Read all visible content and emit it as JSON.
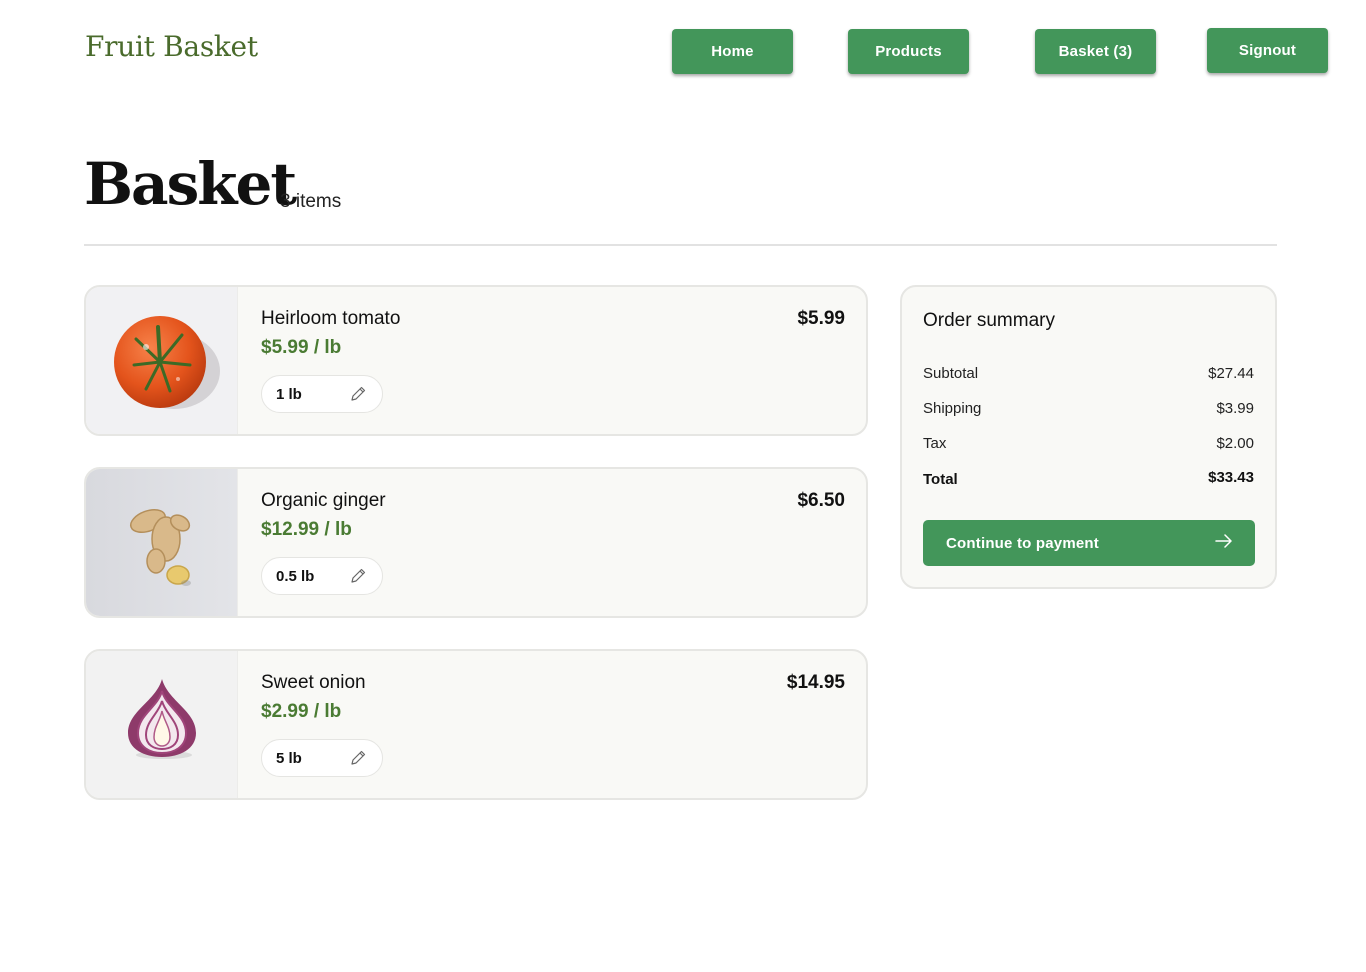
{
  "header": {
    "brand": "Fruit Basket",
    "nav": {
      "home": "Home",
      "products": "Products",
      "basket": "Basket (3)",
      "signout": "Signout"
    }
  },
  "page": {
    "title": "Basket",
    "item_count": "3 items"
  },
  "basket_items": [
    {
      "name": "Heirloom tomato",
      "unit_price": "$5.99 / lb",
      "total": "$5.99",
      "quantity": "1 lb",
      "image": "tomato-image",
      "edit_icon": "pencil-icon"
    },
    {
      "name": "Organic ginger",
      "unit_price": "$12.99 / lb",
      "total": "$6.50",
      "quantity": "0.5 lb",
      "image": "ginger-image",
      "edit_icon": "pencil-icon"
    },
    {
      "name": "Sweet onion",
      "unit_price": "$2.99 / lb",
      "total": "$14.95",
      "quantity": "5 lb",
      "image": "onion-image",
      "edit_icon": "pencil-icon"
    }
  ],
  "summary": {
    "title": "Order summary",
    "rows": [
      {
        "label": "Subtotal",
        "value": "$27.44"
      },
      {
        "label": "Shipping",
        "value": "$3.99"
      },
      {
        "label": "Tax",
        "value": "$2.00"
      }
    ],
    "total": {
      "label": "Total",
      "value": "$33.43"
    },
    "cta": "Continue to payment",
    "cta_icon": "arrow-right-icon"
  },
  "colors": {
    "brand_green": "#43965a",
    "price_green": "#4a7b33",
    "brand_text": "#4a6b2c"
  }
}
